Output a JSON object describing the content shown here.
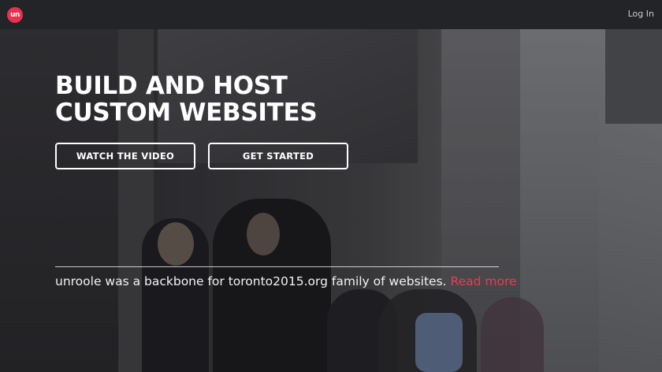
{
  "header": {
    "logo_text": "un",
    "login_label": "Log In",
    "accent_color": "#e8324f"
  },
  "hero": {
    "headline_line1": "BUILD AND HOST",
    "headline_line2": "CUSTOM WEBSITES",
    "watch_video_label": "WATCH THE VIDEO",
    "get_started_label": "GET STARTED",
    "tagline_text": "unroole was a backbone for toronto2015.org  family of websites.",
    "read_more_label": "Read more",
    "read_more_color": "#ea3a57"
  }
}
